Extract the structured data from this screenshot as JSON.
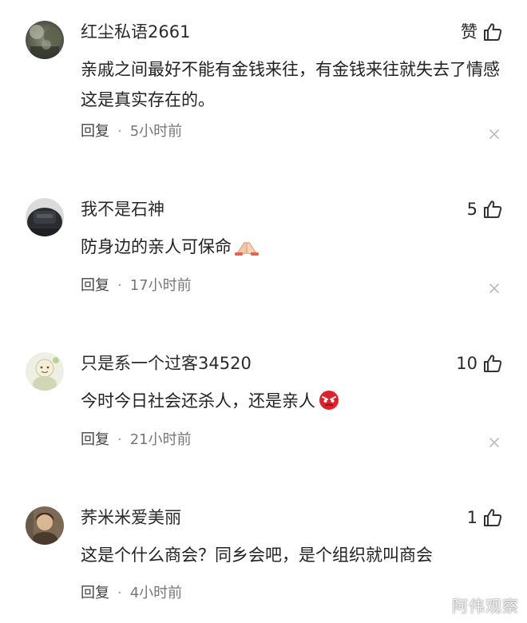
{
  "comments": [
    {
      "username": "红尘私语2661",
      "likes": "赞",
      "text": "亲戚之间最好不能有金钱来往，有金钱来往就失去了情感这是真实存在的。",
      "reply": "回复",
      "separator": "·",
      "time": "5小时前"
    },
    {
      "username": "我不是石神",
      "likes": "5",
      "text": "防身边的亲人可保命",
      "emoji": "pray-hands-emoji",
      "reply": "回复",
      "separator": "·",
      "time": "17小时前"
    },
    {
      "username": "只是系一个过客34520",
      "likes": "10",
      "text": "今时今日社会还杀人，还是亲人",
      "emoji": "angry-face-emoji",
      "reply": "回复",
      "separator": "·",
      "time": "21小时前"
    },
    {
      "username": "荞米米爱美丽",
      "likes": "1",
      "text": "这是个什么商会？同乡会吧，是个组织就叫商会",
      "reply": "回复",
      "separator": "·",
      "time": "4小时前"
    }
  ],
  "watermark": "阿伟观察",
  "colors": {
    "text": "#222222",
    "meta": "#777777",
    "icon": "#333333",
    "close": "#bbbbbb"
  }
}
